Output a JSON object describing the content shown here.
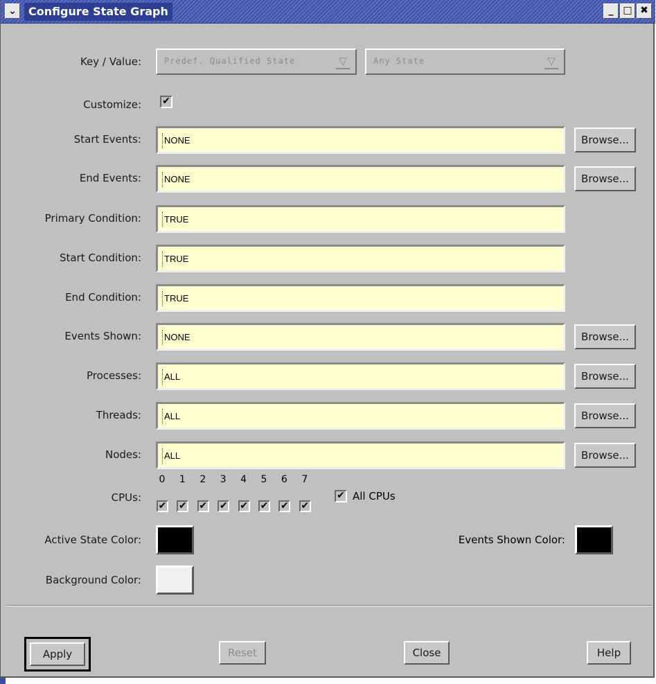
{
  "window": {
    "title": "Configure State Graph",
    "menu_glyph": "✔",
    "minimize": "_",
    "maximize": "□",
    "close": "✖"
  },
  "key_value": {
    "label": "Key / Value:",
    "key_value": "Predef. Qualified State",
    "value_value": "Any State",
    "arrow_glyph": "▽"
  },
  "customize": {
    "label": "Customize:",
    "checked": true
  },
  "check_glyph": "✔",
  "fields": [
    {
      "label": "Start Events:",
      "value": "NONE",
      "browse": "Browse..."
    },
    {
      "label": "End Events:",
      "value": "NONE",
      "browse": "Browse..."
    },
    {
      "label": "Primary Condition:",
      "value": "TRUE",
      "browse": ""
    },
    {
      "label": "Start Condition:",
      "value": "TRUE",
      "browse": ""
    },
    {
      "label": "End Condition:",
      "value": "TRUE",
      "browse": ""
    },
    {
      "label": "Events Shown:",
      "value": "NONE",
      "browse": "Browse..."
    },
    {
      "label": "Processes:",
      "value": "ALL",
      "browse": "Browse..."
    },
    {
      "label": "Threads:",
      "value": "ALL",
      "browse": "Browse..."
    },
    {
      "label": "Nodes:",
      "value": "ALL",
      "browse": "Browse..."
    }
  ],
  "cpus": {
    "label": "CPUs:",
    "numbers": [
      "0",
      "1",
      "2",
      "3",
      "4",
      "5",
      "6",
      "7"
    ],
    "all_label": "All CPUs"
  },
  "colors": {
    "active_state_label": "Active State Color:",
    "active_state_color": "#000000",
    "background_label": "Background Color:",
    "background_color": "#f0f0f0",
    "events_shown_label": "Events Shown Color:",
    "events_shown_color": "#000000"
  },
  "footer": {
    "apply": "Apply",
    "reset": "Reset",
    "close": "Close",
    "help": "Help"
  }
}
